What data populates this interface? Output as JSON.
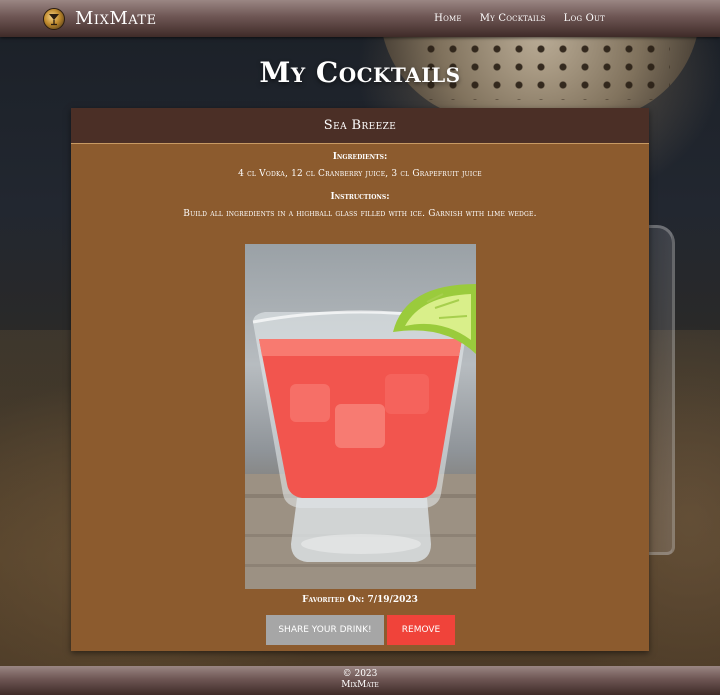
{
  "header": {
    "brand": "MixMate",
    "nav": [
      {
        "label": "Home"
      },
      {
        "label": "My Cocktails"
      },
      {
        "label": "Log Out"
      }
    ]
  },
  "page": {
    "title": "My Cocktails"
  },
  "card": {
    "name": "Sea Breeze",
    "ingredients_label": "Ingredients:",
    "ingredients": "4 cl Vodka, 12 cl Cranberry juice, 3 cl Grapefruit juice",
    "instructions_label": "Instructions:",
    "instructions": "Build all ingredients in a highball glass filled with ice. Garnish with lime wedge.",
    "favorited": "Favorited On: 7/19/2023",
    "share_label": "SHARE YOUR DRINK!",
    "remove_label": "REMOVE"
  },
  "footer": {
    "copyright": "© 2023",
    "brand": "MixMate"
  },
  "colors": {
    "card_bg": "#8c5b2e",
    "card_header_bg": "#4b2f26",
    "share_button": "#a6a6a6",
    "remove_button": "#f0433a"
  },
  "icons": {
    "logo": "cocktail-logo-icon"
  }
}
